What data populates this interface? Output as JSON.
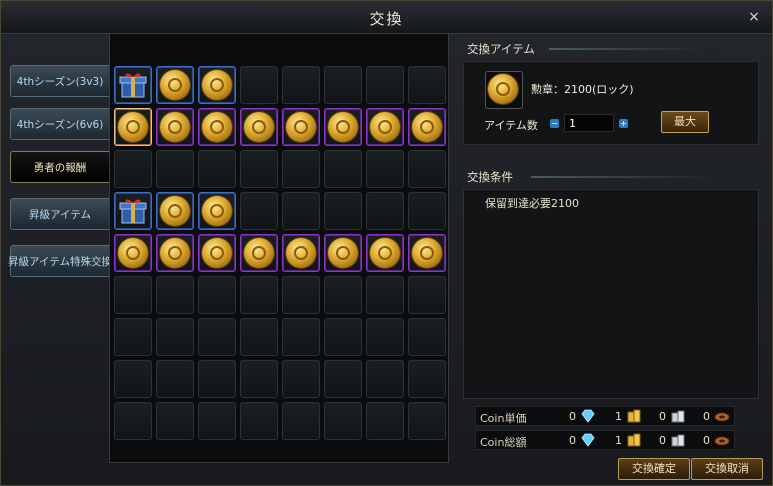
{
  "window": {
    "title": "交換",
    "close_label": "×"
  },
  "tabs": [
    {
      "label": "4thシーズン(3v3)",
      "active": false
    },
    {
      "label": "4thシーズン(6v6)",
      "active": false
    },
    {
      "label": "勇者の報酬",
      "active": true
    },
    {
      "label": "昇級アイテム",
      "active": false
    },
    {
      "label": "昇級アイテム特殊交換",
      "active": false
    }
  ],
  "grid": {
    "rows": [
      [
        "gift-blue",
        "medal-blue",
        "medal-blue",
        "",
        "",
        "",
        "",
        ""
      ],
      [
        "medal-selected",
        "medal-purple",
        "medal-purple",
        "medal-purple",
        "medal-purple",
        "medal-purple",
        "medal-purple",
        "medal-purple"
      ],
      [
        "",
        "",
        "",
        "",
        "",
        "",
        "",
        ""
      ],
      [
        "gift-blue",
        "medal-blue",
        "medal-blue",
        "",
        "",
        "",
        "",
        ""
      ],
      [
        "medal-purple",
        "medal-purple",
        "medal-purple",
        "medal-purple",
        "medal-purple",
        "medal-purple",
        "medal-purple",
        "medal-purple"
      ],
      [
        "",
        "",
        "",
        "",
        "",
        "",
        "",
        ""
      ],
      [
        "",
        "",
        "",
        "",
        "",
        "",
        "",
        ""
      ],
      [
        "",
        "",
        "",
        "",
        "",
        "",
        "",
        ""
      ],
      [
        "",
        "",
        "",
        "",
        "",
        "",
        "",
        ""
      ]
    ]
  },
  "exchange_item": {
    "heading": "交換アイテム",
    "item_name": "勲章：2100(ロック)",
    "icon": "medal-icon",
    "qty_label": "アイテム数",
    "qty_value": "1",
    "minus_label": "−",
    "plus_label": "+",
    "max_label": "最大"
  },
  "conditions": {
    "heading": "交換条件",
    "text": "保留到達必要2100"
  },
  "coins": {
    "unit": {
      "label": "Coin単価",
      "values": [
        "0",
        "1",
        "0",
        "0"
      ]
    },
    "total": {
      "label": "Coin総額",
      "values": [
        "0",
        "1",
        "0",
        "0"
      ]
    },
    "icons": [
      "diamond-icon",
      "gold-coin-stack-icon",
      "silver-coin-stack-icon",
      "copper-coin-icon"
    ]
  },
  "buttons": {
    "confirm": "交換確定",
    "cancel": "交換取消"
  },
  "colors": {
    "accent_gold": "#c9a55b",
    "slot_blue": "#3a6fc7",
    "slot_purple": "#8a35c8",
    "tab_active_text": "#f4e6b8"
  }
}
